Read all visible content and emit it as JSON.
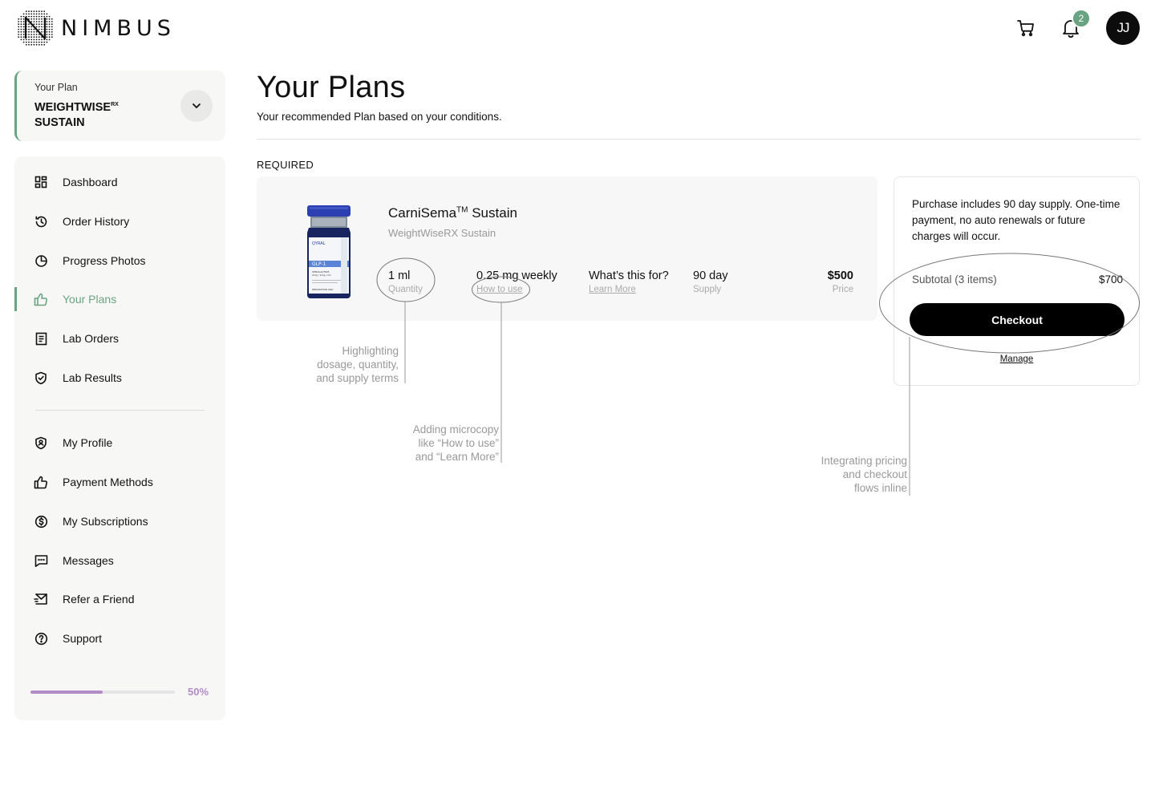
{
  "brand": {
    "name": "NIMBUS"
  },
  "header": {
    "notification_count": "2",
    "avatar_initials": "JJ"
  },
  "plan": {
    "label": "Your Plan",
    "name_main": "WEIGHTWISE",
    "name_sup": "Rx",
    "name_line2": "SUSTAIN"
  },
  "nav": {
    "items": [
      {
        "label": "Dashboard",
        "icon": "dashboard-icon"
      },
      {
        "label": "Order History",
        "icon": "history-icon"
      },
      {
        "label": "Progress Photos",
        "icon": "pie-chart-icon"
      },
      {
        "label": "Your Plans",
        "icon": "thumbs-up-icon",
        "active": true
      },
      {
        "label": "Lab Orders",
        "icon": "document-icon"
      },
      {
        "label": "Lab Results",
        "icon": "shield-check-icon"
      },
      {
        "label": "My Profile",
        "icon": "profile-shield-icon"
      },
      {
        "label": "Payment Methods",
        "icon": "thumbs-up-icon"
      },
      {
        "label": "My Subscriptions",
        "icon": "dollar-circle-icon"
      },
      {
        "label": "Messages",
        "icon": "chat-icon"
      },
      {
        "label": "Refer a Friend",
        "icon": "send-mail-icon"
      },
      {
        "label": "Support",
        "icon": "help-circle-icon"
      }
    ],
    "progress": {
      "value": 0.5,
      "label": "50%"
    }
  },
  "main": {
    "title": "Your Plans",
    "subtitle": "Your recommended Plan based on your conditions.",
    "section_label": "REQUIRED"
  },
  "product": {
    "name": "CarniSema",
    "name_sup": "TM",
    "name_suffix": " Sustain",
    "subtitle": "WeightWiseRX Sustain",
    "vial": {
      "brand": "QYRAL",
      "label": "GLP-1",
      "line1": "SEMAGLUTIDE",
      "line2": "2mg / 1mg / mL",
      "line3": "PRESCRIPTION ONLY"
    },
    "quantity": {
      "value": "1 ml",
      "label": "Quantity"
    },
    "dosage": {
      "value": "0.25 mg weekly",
      "label": "How to use"
    },
    "purpose": {
      "value": "What’s this for?",
      "label": "Learn More"
    },
    "supply": {
      "value": "90 day",
      "label": "Supply"
    },
    "price": {
      "value": "$500",
      "label": "Price"
    }
  },
  "checkout": {
    "note": "Purchase includes 90 day supply. One-time payment, no auto renewals or future charges will occur.",
    "subtotal_label": "Subtotal (3 items)",
    "subtotal_value": "$700",
    "button_label": "Checkout",
    "manage_label": "Manage"
  },
  "annotations": {
    "a1": [
      "Highlighting",
      "dosage, quantity,",
      "and supply terms"
    ],
    "a2": [
      "Adding microcopy",
      "like “How to use”",
      "and “Learn More”"
    ],
    "a3": [
      "Integrating pricing",
      "and checkout",
      "flows inline"
    ]
  },
  "colors": {
    "accent_green": "#6aa382",
    "progress_purple": "#b38cc7"
  }
}
